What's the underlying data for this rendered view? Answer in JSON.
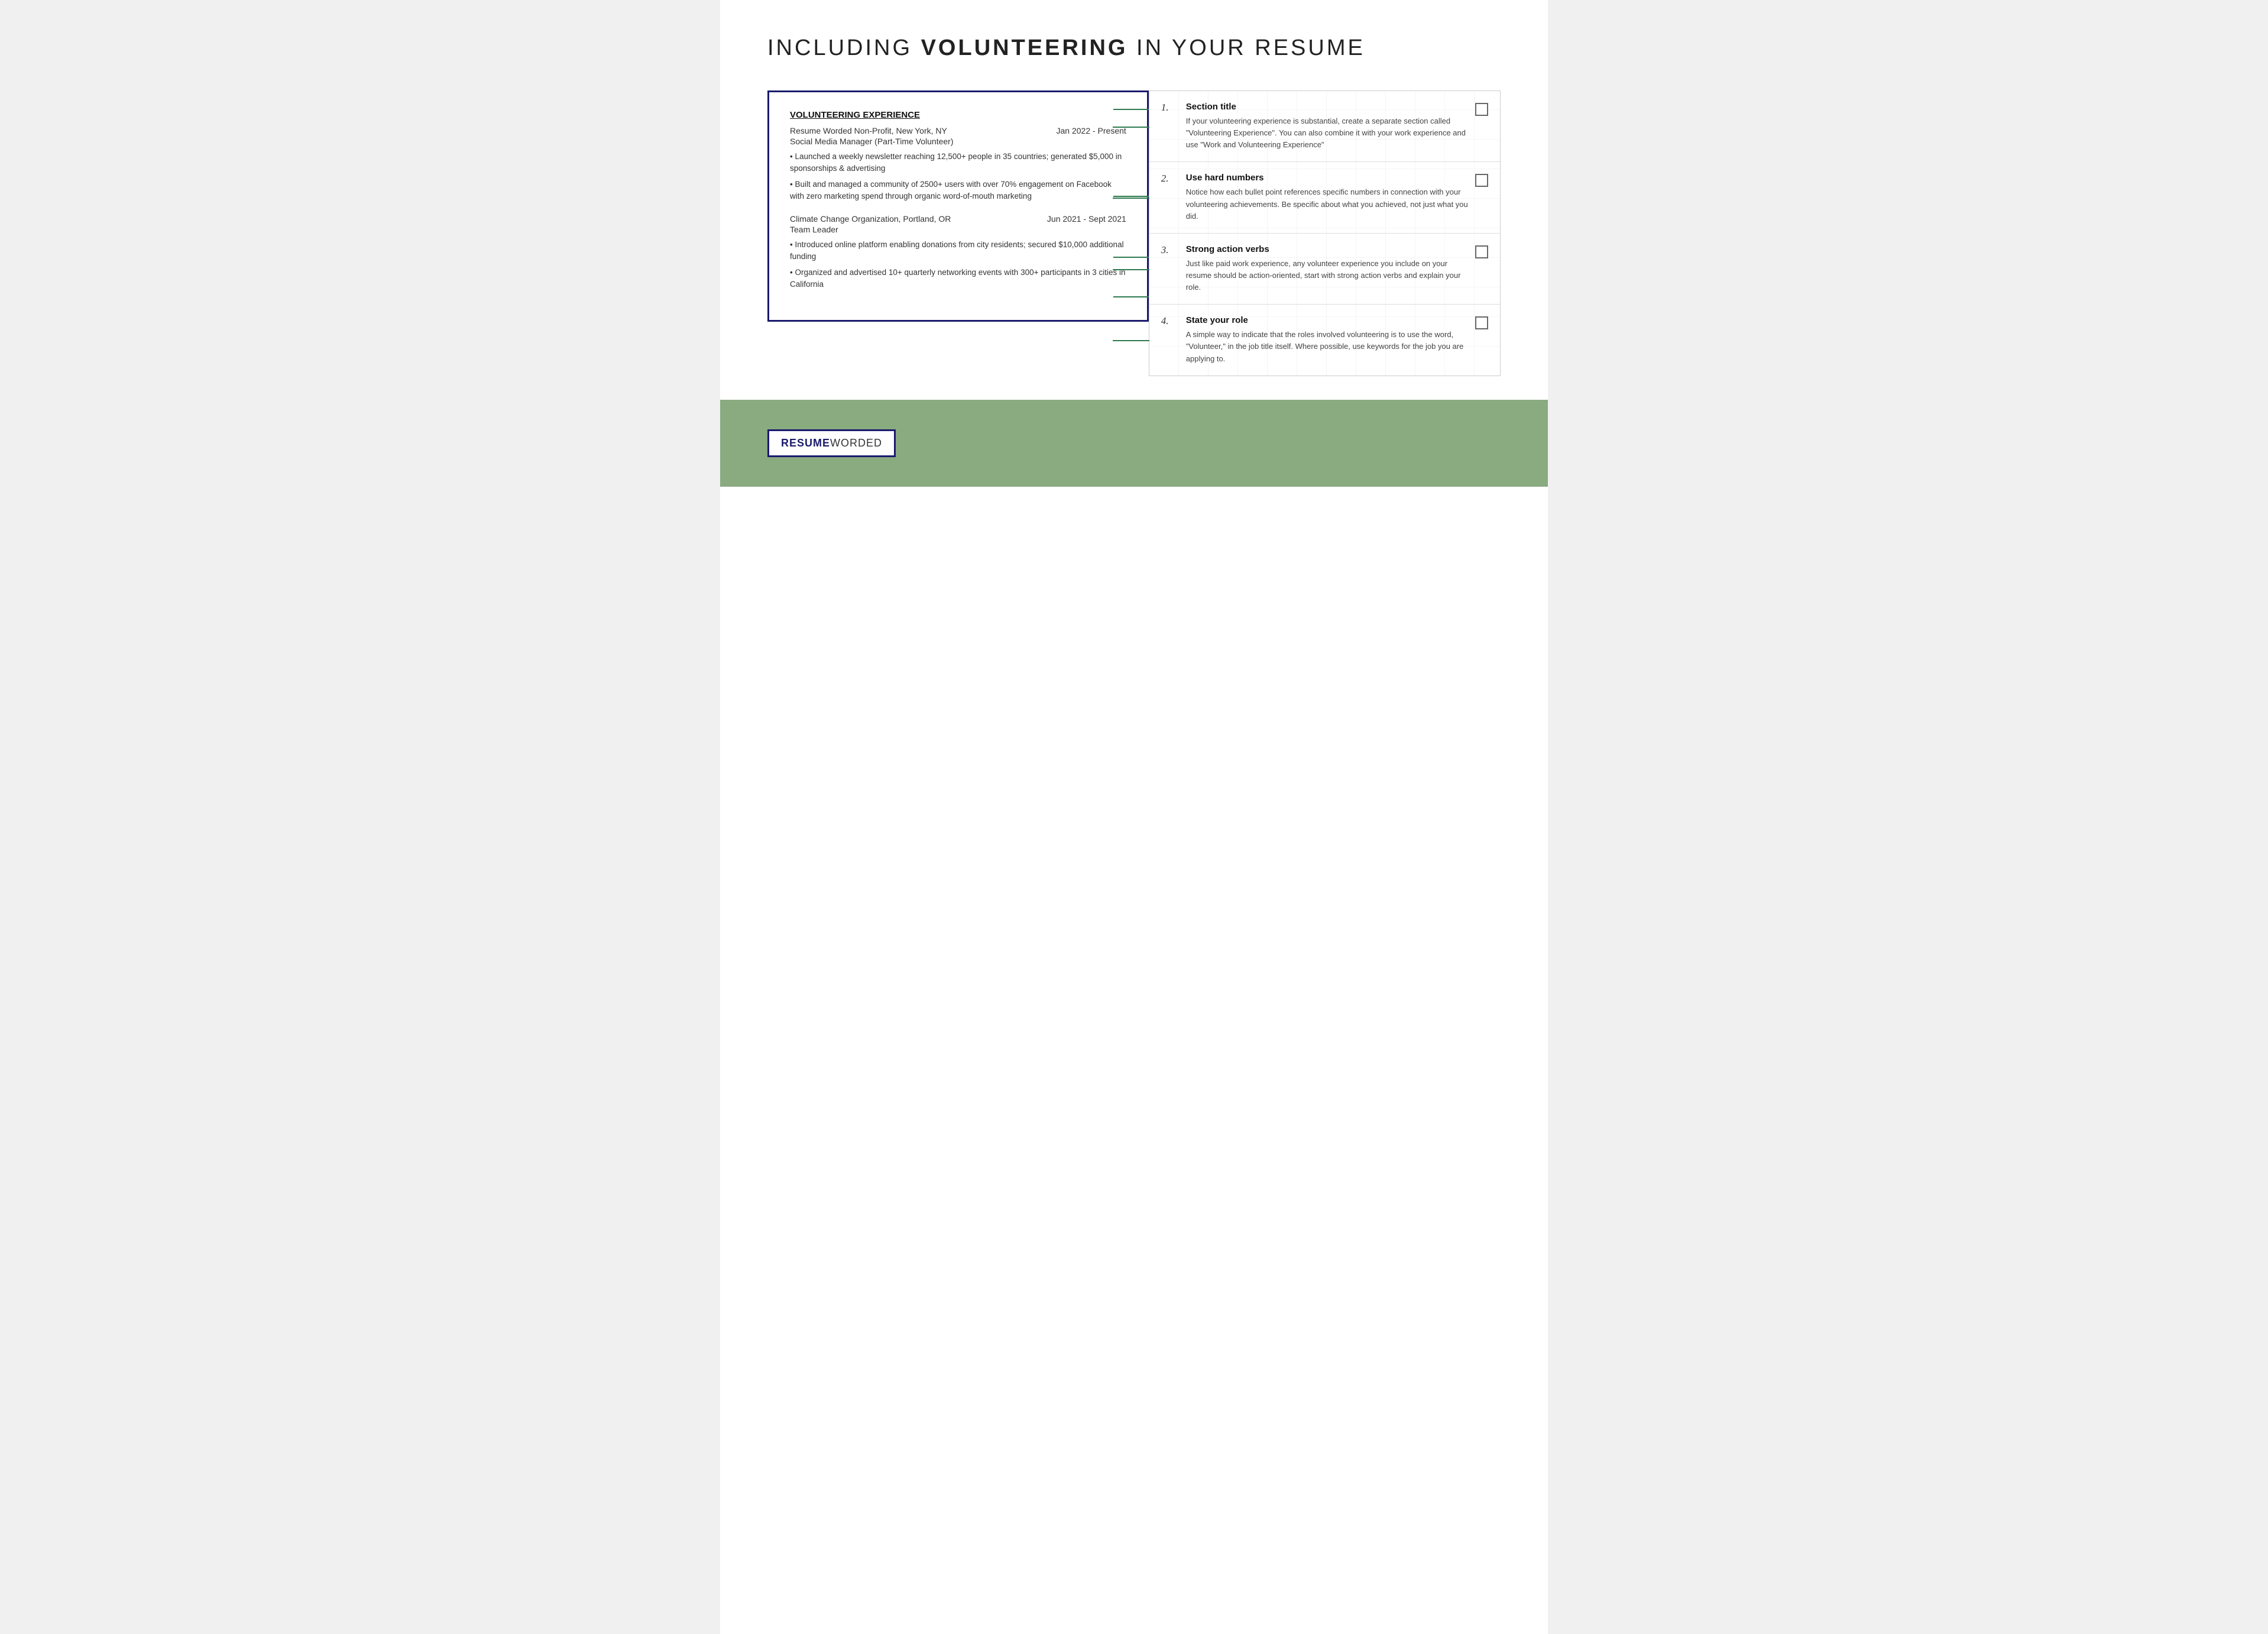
{
  "page": {
    "title_normal": "INCLUDING ",
    "title_bold": "VOLUNTEERING",
    "title_end": " IN YOUR RESUME"
  },
  "resume": {
    "section_title": "VOLUNTEERING EXPERIENCE",
    "entry1": {
      "org": "Resume Worded Non-Profit, New York, NY",
      "dates": "Jan 2022 - Present",
      "role": "Social Media Manager (Part-Time Volunteer)",
      "bullet1": "• Launched a weekly newsletter reaching 12,500+ people in 35 countries; generated $5,000 in sponsorships & advertising",
      "bullet2": "• Built and managed a community of 2500+ users with over 70% engagement on Facebook with zero marketing spend through organic word-of-mouth marketing"
    },
    "entry2": {
      "org": "Climate Change Organization, Portland, OR",
      "dates": "Jun 2021 - Sept 2021",
      "role": "Team Leader",
      "bullet1": "• Introduced online platform enabling donations from city residents; secured $10,000 additional funding",
      "bullet2": "• Organized and advertised 10+ quarterly networking events with 300+ participants in 3 cities in California"
    }
  },
  "tips": [
    {
      "number": "1.",
      "title": "Section title",
      "description": "If your volunteering experience is substantial, create a separate section called \"Volunteering Experience\". You can also combine it with your work experience and use \"Work and Volunteering Experience\""
    },
    {
      "number": "2.",
      "title": "Use hard numbers",
      "description": "Notice how each bullet point references specific numbers in connection with your volunteering achievements. Be specific about what you achieved, not just what you did."
    },
    {
      "number": "3.",
      "title": "Strong action verbs",
      "description": "Just like paid work experience, any volunteer experience you include on your resume should be action-oriented, start with strong action verbs and explain your role."
    },
    {
      "number": "4.",
      "title": "State your role",
      "description": "A simple way to indicate that the roles involved volunteering is to use the word, \"Volunteer,\" in the job title itself. Where possible, use keywords for the job you are applying to."
    }
  ],
  "footer": {
    "logo_resume": "RESUME",
    "logo_worded": " WORDED"
  }
}
